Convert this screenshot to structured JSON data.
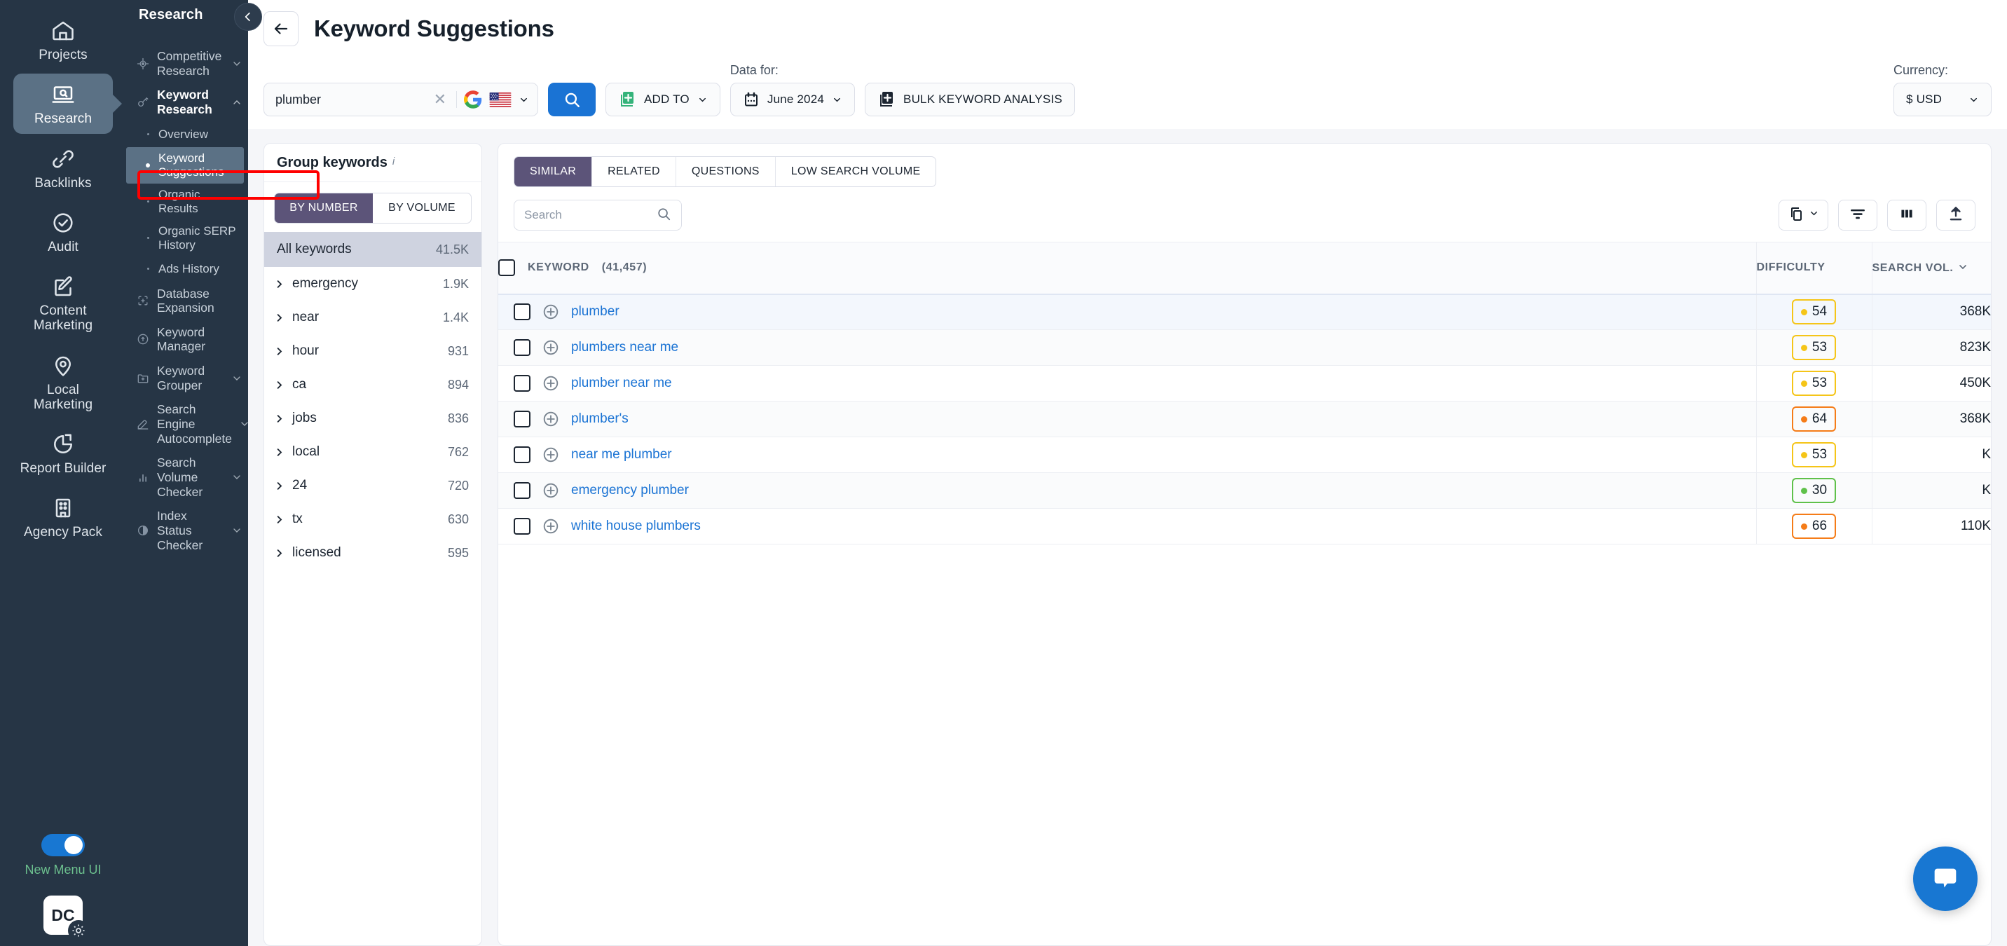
{
  "rail": {
    "items": [
      {
        "label": "Projects",
        "icon": "home-icon",
        "active": false
      },
      {
        "label": "Research",
        "icon": "laptop-search-icon",
        "active": true
      },
      {
        "label": "Backlinks",
        "icon": "link-icon",
        "active": false
      },
      {
        "label": "Audit",
        "icon": "check-circle-icon",
        "active": false
      },
      {
        "label": "Content\nMarketing",
        "icon": "edit-square-icon",
        "active": false
      },
      {
        "label": "Local\nMarketing",
        "icon": "map-pin-icon",
        "active": false
      },
      {
        "label": "Report\nBuilder",
        "icon": "pie-chart-icon",
        "active": false
      },
      {
        "label": "Agency\nPack",
        "icon": "building-icon",
        "active": false
      }
    ],
    "toggle_label": "New Menu UI",
    "toggle_on": true,
    "avatar_initials": "DC"
  },
  "nav": {
    "title": "Research",
    "collapse_icon": "chevron-left-icon",
    "groups": [
      {
        "label": "Competitive Research",
        "icon": "target-icon",
        "chevron": "chevron-down-icon"
      },
      {
        "label": "Keyword Research",
        "icon": "key-icon",
        "chevron": "chevron-up-icon",
        "children": [
          {
            "label": "Overview",
            "current": false
          },
          {
            "label": "Keyword Suggestions",
            "current": true
          },
          {
            "label": "Organic Results",
            "current": false
          },
          {
            "label": "Organic SERP History",
            "current": false
          },
          {
            "label": "Ads History",
            "current": false
          }
        ]
      },
      {
        "label": "Database Expansion",
        "icon": "expand-icon",
        "chevron": ""
      },
      {
        "label": "Keyword Manager",
        "icon": "clock-arrow-icon",
        "chevron": ""
      },
      {
        "label": "Keyword Grouper",
        "icon": "folder-plus-icon",
        "chevron": "chevron-down-icon"
      },
      {
        "label": "Search Engine Autocomplete",
        "icon": "pencil-icon",
        "chevron": "chevron-down-icon"
      },
      {
        "label": "Search Volume Checker",
        "icon": "bar-chart-icon",
        "chevron": "chevron-down-icon"
      },
      {
        "label": "Index Status Checker",
        "icon": "half-circle-icon",
        "chevron": "chevron-down-icon"
      }
    ]
  },
  "header": {
    "back_icon": "arrow-left-icon",
    "title": "Keyword Suggestions"
  },
  "search": {
    "value": "plumber",
    "clear_icon": "close-icon",
    "engine_icon": "google-icon",
    "country_icon": "us-flag-icon",
    "dropdown_icon": "chevron-down-icon",
    "submit_icon": "search-icon"
  },
  "toolbar": {
    "add_to_label": "ADD TO",
    "add_to_icon": "add-to-list-icon",
    "data_for_label": "Data for:",
    "date_value": "June 2024",
    "date_icon": "calendar-icon",
    "bulk_label": "BULK KEYWORD ANALYSIS",
    "bulk_icon": "bulk-add-icon",
    "currency_label": "Currency:",
    "currency_value": "$ USD"
  },
  "group_panel": {
    "title": "Group keywords",
    "info_icon": "info-icon",
    "segments": [
      {
        "label": "BY NUMBER",
        "active": true
      },
      {
        "label": "BY VOLUME",
        "active": false
      }
    ],
    "all_label": "All keywords",
    "all_count": "41.5K",
    "rows": [
      {
        "name": "emergency",
        "count": "1.9K"
      },
      {
        "name": "near",
        "count": "1.4K"
      },
      {
        "name": "hour",
        "count": "931"
      },
      {
        "name": "ca",
        "count": "894"
      },
      {
        "name": "jobs",
        "count": "836"
      },
      {
        "name": "local",
        "count": "762"
      },
      {
        "name": "24",
        "count": "720"
      },
      {
        "name": "tx",
        "count": "630"
      },
      {
        "name": "licensed",
        "count": "595"
      }
    ]
  },
  "results": {
    "tabs": [
      {
        "label": "SIMILAR",
        "active": true
      },
      {
        "label": "RELATED",
        "active": false
      },
      {
        "label": "QUESTIONS",
        "active": false
      },
      {
        "label": "LOW SEARCH VOLUME",
        "active": false
      }
    ],
    "search_placeholder": "Search",
    "search_value": "",
    "search_icon": "search-icon",
    "tool_buttons": [
      {
        "icon": "copy-columns-icon",
        "has_chevron": true
      },
      {
        "icon": "filter-icon",
        "has_chevron": false
      },
      {
        "icon": "columns-icon",
        "has_chevron": false
      },
      {
        "icon": "export-upload-icon",
        "has_chevron": false
      }
    ],
    "columns": {
      "keyword": "KEYWORD",
      "keyword_count": "(41,457)",
      "difficulty": "DIFFICULTY",
      "volume": "SEARCH VOL.",
      "sort_icon": "chevron-down-icon"
    },
    "rows": [
      {
        "keyword": "plumber",
        "difficulty": "54",
        "level": "yellow",
        "volume": "368K"
      },
      {
        "keyword": "plumbers near me",
        "difficulty": "53",
        "level": "yellow",
        "volume": "823K"
      },
      {
        "keyword": "plumber near me",
        "difficulty": "53",
        "level": "yellow",
        "volume": "450K"
      },
      {
        "keyword": "plumber's",
        "difficulty": "64",
        "level": "orange",
        "volume": "368K"
      },
      {
        "keyword": "near me plumber",
        "difficulty": "53",
        "level": "yellow",
        "volume": "K"
      },
      {
        "keyword": "emergency plumber",
        "difficulty": "30",
        "level": "green",
        "volume": "K"
      },
      {
        "keyword": "white house plumbers",
        "difficulty": "66",
        "level": "orange",
        "volume": "110K"
      }
    ]
  },
  "chat": {
    "icon": "chat-bubble-icon"
  },
  "colors": {
    "rail_bg": "#263545",
    "rail_active": "#5b7185",
    "accent_blue": "#1a73d4",
    "segment_purple": "#5c5479",
    "link_blue": "#1a73d4",
    "difficulty_yellow": "#f5c518",
    "difficulty_orange": "#f57c18",
    "difficulty_green": "#5fc14a",
    "highlight_red": "#ff0000",
    "toggle_green_text": "#6cbf8e"
  }
}
